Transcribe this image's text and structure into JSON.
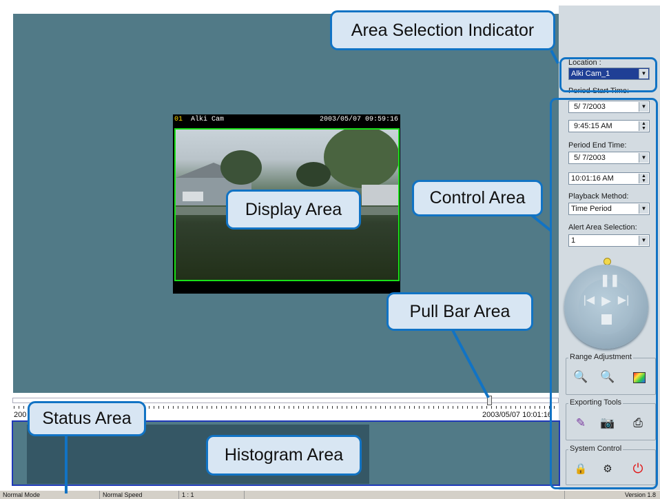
{
  "video": {
    "channel": "01",
    "camera_name": "Alki Cam",
    "timestamp": "2003/05/07 09:59:16"
  },
  "controls": {
    "location_label": "Location :",
    "location_value": "Alki Cam_1",
    "start_label": "Period Start Time:",
    "start_date": "5/ 7/2003",
    "start_time": "9:45:15 AM",
    "end_label": "Period End Time:",
    "end_date": "5/ 7/2003",
    "end_time": "10:01:16 AM",
    "playback_label": "Playback Method:",
    "playback_value": "Time Period",
    "alert_label": "Alert Area Selection:",
    "alert_value": "1"
  },
  "groups": {
    "range": "Range Adjustment",
    "export": "Exporting Tools",
    "system": "System Control"
  },
  "timeline": {
    "start_fragment": "200",
    "end_timestamp": "2003/05/07 10:01:16",
    "position": 0.873
  },
  "status_bar": {
    "mode": "Normal Mode",
    "speed": "Normal Speed",
    "ratio": "1 : 1",
    "version": "Version 1.8"
  },
  "callouts": {
    "area_selection": "Area Selection Indicator",
    "display": "Display Area",
    "control": "Control  Area",
    "pull_bar": "Pull Bar  Area",
    "status": "Status Area",
    "histogram": "Histogram Area"
  },
  "colors": {
    "display_bg": "#517a87",
    "callout_border": "#1173c4",
    "callout_fill": "#d8e6f3",
    "video_frame": "#19e019",
    "histogram_border": "#1e38b8"
  }
}
